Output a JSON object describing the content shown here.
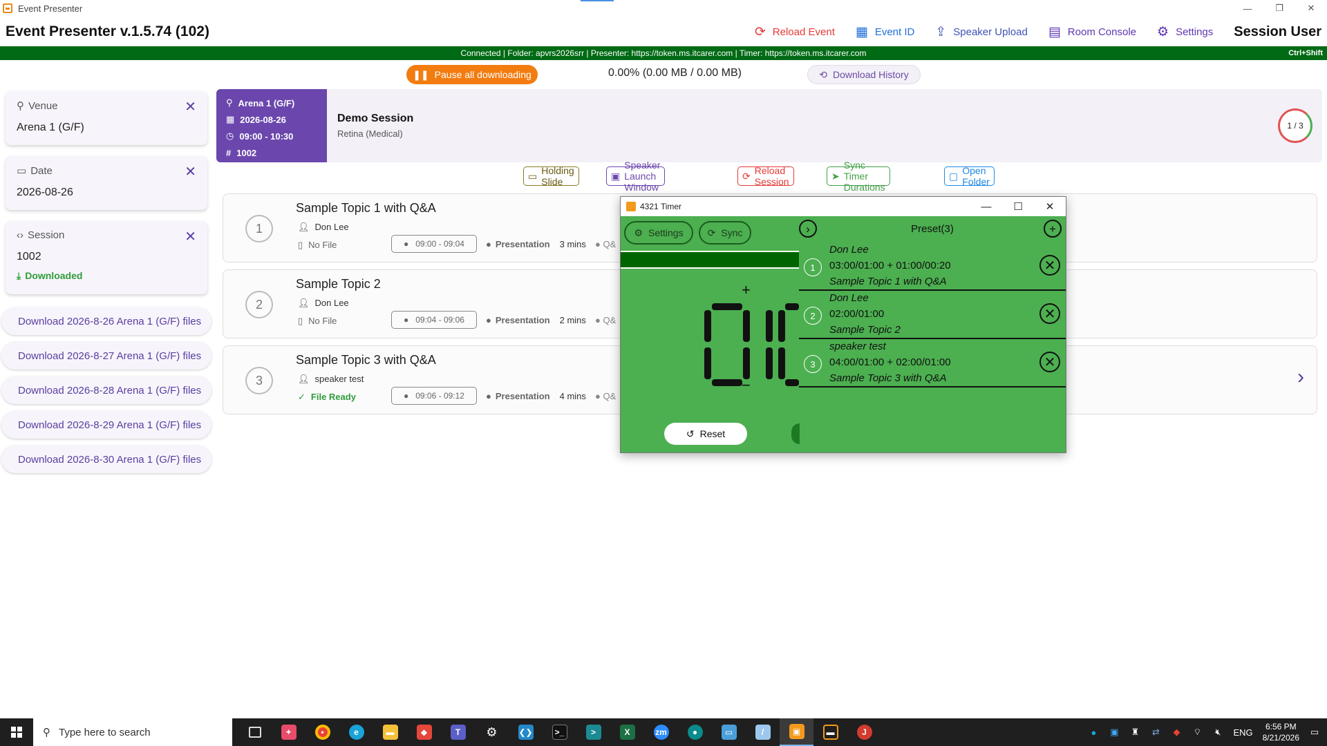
{
  "window": {
    "title": "Event Presenter",
    "controls": [
      "—",
      "❐",
      "✕"
    ]
  },
  "header": {
    "app_title": "Event Presenter v.1.5.74 (102)",
    "actions": [
      {
        "label": "Reload Event",
        "icon": "reload-icon",
        "color": "#e53935"
      },
      {
        "label": "Event ID",
        "icon": "qr-code-icon",
        "color": "#1e6fd9"
      },
      {
        "label": "Speaker Upload",
        "icon": "upload-icon",
        "color": "#3f51b5"
      },
      {
        "label": "Room Console",
        "icon": "room-console-icon",
        "color": "#5e35b1"
      },
      {
        "label": "Settings",
        "icon": "gear-icon",
        "color": "#5e35b1"
      }
    ],
    "user": "Session User"
  },
  "status_bar": {
    "text": "Connected | Folder: apvrs2026srr | Presenter: https://token.ms.itcarer.com | Timer: https://token.ms.itcarer.com",
    "shortcut": "Ctrl+Shift",
    "color": "#006a14"
  },
  "download_bar": {
    "pause_label": "Pause all downloading",
    "progress": "0.00% (0.00 MB / 0.00 MB)",
    "history_label": "Download History"
  },
  "filters": {
    "venue": {
      "label": "Venue",
      "value": "Arena 1 (G/F)"
    },
    "date": {
      "label": "Date",
      "value": "2026-08-26"
    },
    "session": {
      "label": "Session",
      "value": "1002",
      "status": "Downloaded"
    }
  },
  "download_buttons": [
    "Download 2026-8-26 Arena 1 (G/F) files",
    "Download 2026-8-27 Arena 1 (G/F) files",
    "Download 2026-8-28 Arena 1 (G/F) files",
    "Download 2026-8-29 Arena 1 (G/F) files",
    "Download 2026-8-30 Arena 1 (G/F) files"
  ],
  "session": {
    "venue": "Arena 1 (G/F)",
    "date": "2026-08-26",
    "time": "09:00 - 10:30",
    "id": "1002",
    "title": "Demo Session",
    "subtitle": "Retina (Medical)",
    "count": "1 / 3"
  },
  "session_actions": [
    {
      "label": "Holding Slide",
      "icon": "slide-icon",
      "color": "#6b5a12"
    },
    {
      "label": "Speaker Launch Window",
      "icon": "launch-window-icon",
      "color": "#6b47ad"
    },
    {
      "label": "Reload Session",
      "icon": "reload-icon",
      "color": "#e53935"
    },
    {
      "label": "Sync Timer Durations",
      "icon": "send-icon",
      "color": "#43a047"
    },
    {
      "label": "Open Folder",
      "icon": "folder-icon",
      "color": "#1e88e5"
    }
  ],
  "topics": [
    {
      "num": "1",
      "title": "Sample Topic 1 with Q&A",
      "speaker": "Don Lee",
      "file": "No File",
      "time": "09:00 - 09:04",
      "type": "Presentation",
      "duration": "3 mins",
      "qa": "Q&"
    },
    {
      "num": "2",
      "title": "Sample Topic 2",
      "speaker": "Don Lee",
      "file": "No File",
      "time": "09:04 - 09:06",
      "type": "Presentation",
      "duration": "2 mins",
      "qa": "Q&"
    },
    {
      "num": "3",
      "title": "Sample Topic 3 with Q&A",
      "speaker": "speaker test",
      "file": "File Ready",
      "time": "09:06 - 09:12",
      "type": "Presentation",
      "duration": "4 mins",
      "qa": "Q&"
    }
  ],
  "timer": {
    "title": "4321 Timer",
    "settings_label": "Settings",
    "sync_label": "Sync",
    "display_digits": "0",
    "plus": "+",
    "minus": "−",
    "reset_label": "Reset",
    "preset_title": "Preset(3)",
    "presets": [
      {
        "num": "1",
        "speaker": "Don Lee",
        "timing": "03:00/01:00 + 01:00/00:20",
        "topic": "Sample Topic 1 with Q&A"
      },
      {
        "num": "2",
        "speaker": "Don Lee",
        "timing": "02:00/01:00",
        "topic": "Sample Topic 2"
      },
      {
        "num": "3",
        "speaker": "speaker test",
        "timing": "04:00/01:00 + 02:00/01:00",
        "topic": "Sample Topic 3 with Q&A"
      }
    ]
  },
  "taskbar": {
    "search_placeholder": "Type here to search",
    "time": "6:56 PM",
    "date": "8/21/2026",
    "language": "ENG"
  }
}
